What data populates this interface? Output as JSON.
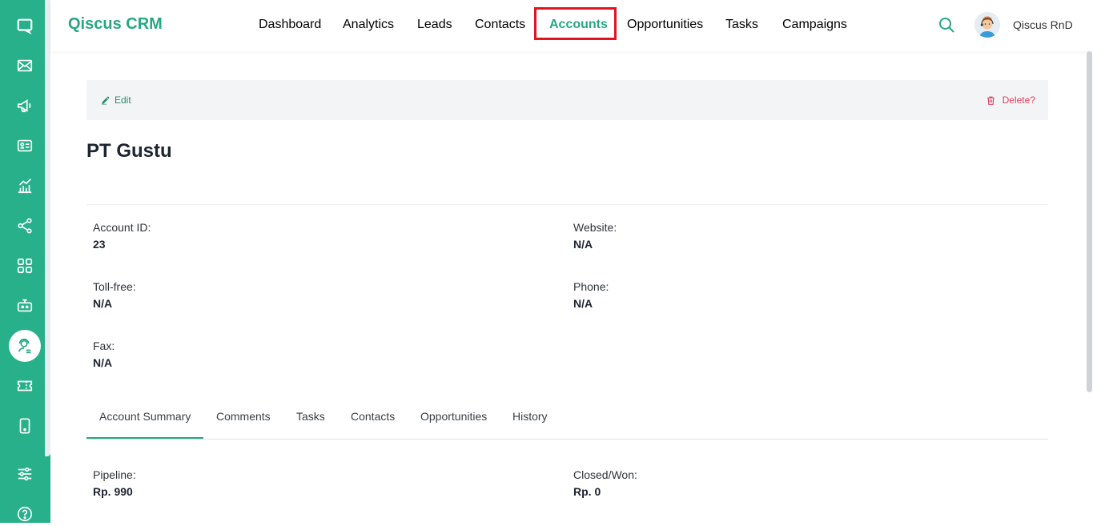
{
  "app": {
    "brand": "Qiscus CRM"
  },
  "nav": {
    "items": [
      {
        "label": "Dashboard"
      },
      {
        "label": "Analytics"
      },
      {
        "label": "Leads"
      },
      {
        "label": "Contacts"
      },
      {
        "label": "Accounts",
        "active": true
      },
      {
        "label": "Opportunities"
      },
      {
        "label": "Tasks"
      },
      {
        "label": "Campaigns"
      }
    ]
  },
  "user": {
    "name": "Qiscus RnD"
  },
  "sidebar": {
    "icons": [
      "chat-icon",
      "mail-icon",
      "megaphone-icon",
      "id-card-icon",
      "chart-icon",
      "share-icon",
      "apps-icon",
      "bot-icon",
      "agent-icon",
      "ticket-icon",
      "mobile-icon",
      "settings-sliders-icon",
      "help-icon"
    ],
    "active": "agent-icon"
  },
  "actions": {
    "edit": "Edit",
    "delete": "Delete?"
  },
  "account": {
    "title": "PT Gustu",
    "fields": {
      "account_id": {
        "label": "Account ID:",
        "value": "23"
      },
      "website": {
        "label": "Website:",
        "value": "N/A"
      },
      "toll_free": {
        "label": "Toll-free:",
        "value": "N/A"
      },
      "phone": {
        "label": "Phone:",
        "value": "N/A"
      },
      "fax": {
        "label": "Fax:",
        "value": "N/A"
      }
    }
  },
  "tabs": [
    {
      "label": "Account Summary",
      "active": true
    },
    {
      "label": "Comments"
    },
    {
      "label": "Tasks"
    },
    {
      "label": "Contacts"
    },
    {
      "label": "Opportunities"
    },
    {
      "label": "History"
    }
  ],
  "summary": {
    "pipeline": {
      "label": "Pipeline:",
      "value": "Rp. 990"
    },
    "closed_won": {
      "label": "Closed/Won:",
      "value": "Rp. 0"
    }
  },
  "colors": {
    "brand": "#27b08a",
    "accent": "#27a882",
    "danger": "#e0405f",
    "highlight": "#e0141e"
  }
}
